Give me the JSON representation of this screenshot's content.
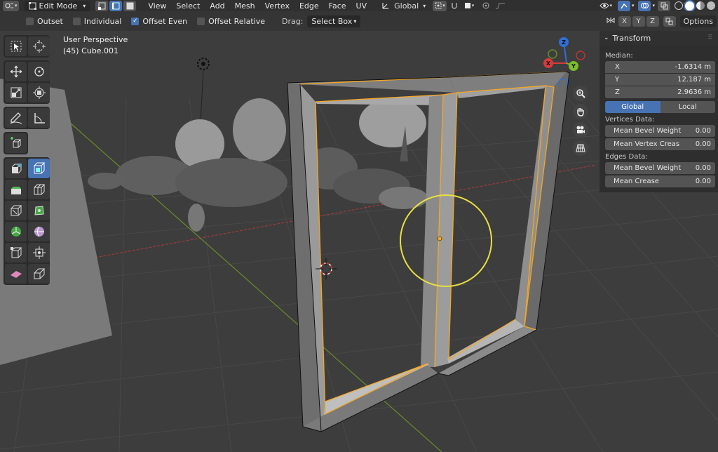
{
  "header": {
    "mode": "Edit Mode",
    "menus": [
      "View",
      "Select",
      "Add",
      "Mesh",
      "Vertex",
      "Edge",
      "Face",
      "UV"
    ],
    "orientation": "Global"
  },
  "tool_options": {
    "outset": "Outset",
    "individual": "Individual",
    "offset_even": "Offset Even",
    "offset_relative": "Offset Relative",
    "drag_label": "Drag:",
    "drag_value": "Select Box",
    "axis_x": "X",
    "axis_y": "Y",
    "axis_z": "Z",
    "options": "Options"
  },
  "viewport": {
    "perspective": "User Perspective",
    "object": "(45) Cube.001",
    "gizmo": {
      "x": "X",
      "y": "Y",
      "z": "Z"
    }
  },
  "transform_panel": {
    "title": "Transform",
    "median_label": "Median:",
    "x_label": "X",
    "x_value": "-1.6314 m",
    "y_label": "Y",
    "y_value": "12.187 m",
    "z_label": "Z",
    "z_value": "2.9636 m",
    "global": "Global",
    "local": "Local",
    "vertices_label": "Vertices Data:",
    "mean_bevel_weight_v": "Mean Bevel Weight",
    "mean_bevel_weight_v_value": "0.00",
    "mean_vertex_crease": "Mean Vertex Creas",
    "mean_vertex_crease_value": "0.00",
    "edges_label": "Edges Data:",
    "mean_bevel_weight_e": "Mean Bevel Weight",
    "mean_bevel_weight_e_value": "0.00",
    "mean_crease": "Mean Crease",
    "mean_crease_value": "0.00"
  },
  "colors": {
    "accent": "#4772b3",
    "selection": "#f5a623",
    "brush_circle": "#e8e040"
  }
}
